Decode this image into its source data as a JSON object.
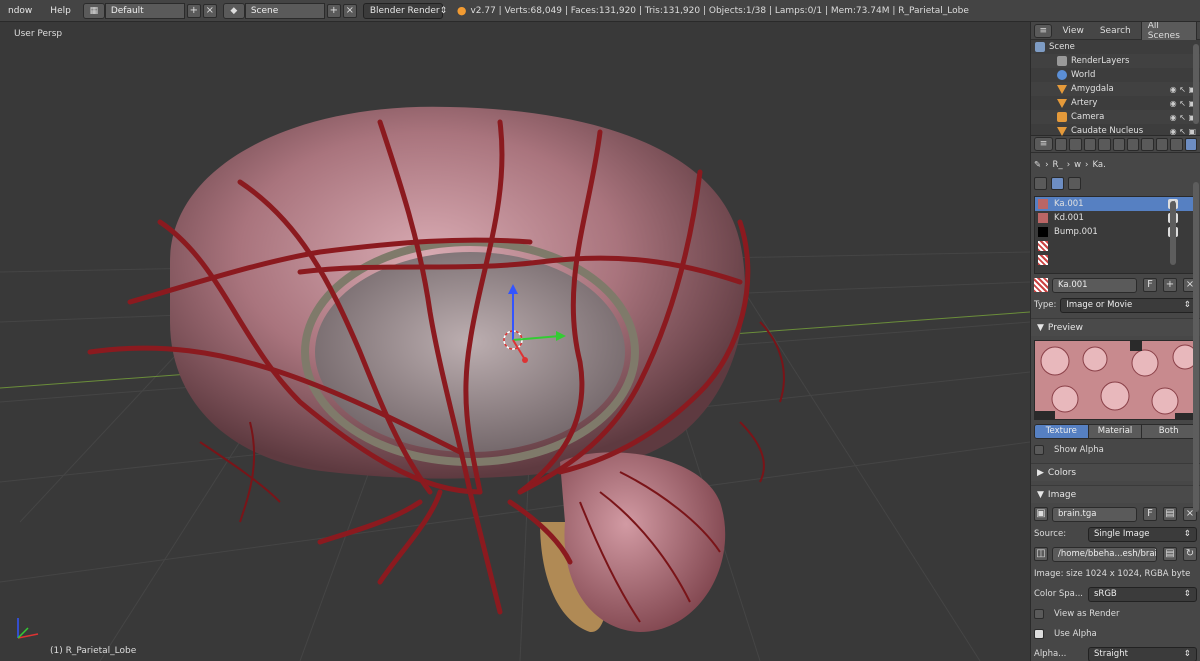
{
  "menu": {
    "window": "ndow",
    "help": "Help"
  },
  "layout": {
    "value": "Default"
  },
  "scene": {
    "value": "Scene"
  },
  "engine": {
    "value": "Blender Render"
  },
  "stats": {
    "text": "v2.77 | Verts:68,049 | Faces:131,920 | Tris:131,920 | Objects:1/38 | Lamps:0/1 | Mem:73.74M | R_Parietal_Lobe"
  },
  "viewport": {
    "view_label": "User Persp",
    "object_label": "(1) R_Parietal_Lobe"
  },
  "outliner": {
    "tabs": [
      "View",
      "Search",
      "All Scenes"
    ],
    "items": [
      {
        "label": "Scene"
      },
      {
        "label": "RenderLayers"
      },
      {
        "label": "World"
      },
      {
        "label": "Amygdala"
      },
      {
        "label": "Artery"
      },
      {
        "label": "Camera"
      },
      {
        "label": "Caudate Nucleus"
      }
    ]
  },
  "properties": {
    "breadcrumb": [
      "R_",
      "w",
      "Ka."
    ],
    "texture_slots": [
      "Ka.001",
      "Kd.001",
      "Bump.001"
    ],
    "texture_name": "Ka.001",
    "type_label": "Type:",
    "type_value": "Image or Movie",
    "preview_title": "Preview",
    "preview_tabs": [
      "Texture",
      "Material",
      "Both"
    ],
    "show_alpha": "Show Alpha",
    "colors_title": "Colors",
    "image_title": "Image",
    "image_name": "brain.tga",
    "source_label": "Source:",
    "source_value": "Single Image",
    "filepath": "/home/bbeha...esh/brain.tga",
    "image_info": "Image: size 1024 x 1024, RGBA byte",
    "colorspace_label": "Color Spa...",
    "colorspace_value": "sRGB",
    "view_as_render": "View as Render",
    "use_alpha": "Use Alpha",
    "alpha_label": "Alpha...",
    "alpha_value": "Straight"
  },
  "colors": {
    "accent": "#5680c2",
    "artery": "#8b1a1f",
    "brain": "#b98a92"
  }
}
